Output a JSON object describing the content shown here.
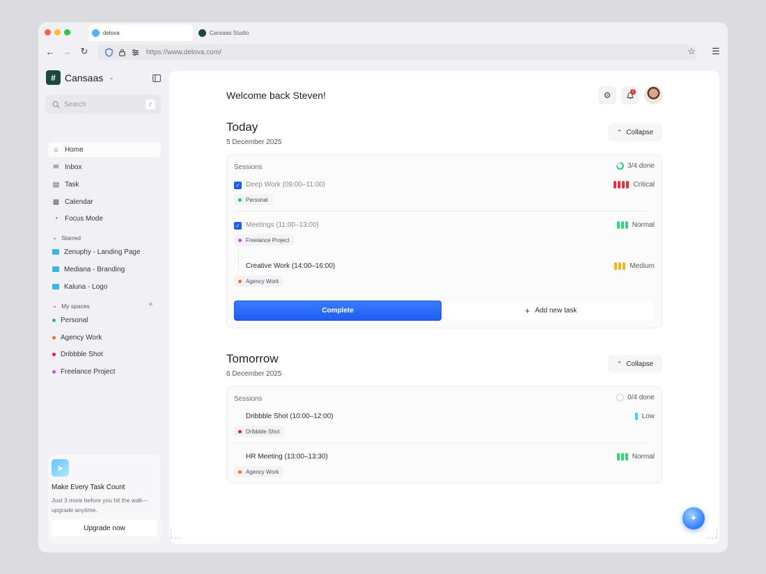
{
  "browser": {
    "tabs": [
      {
        "label": "delova",
        "favicon_color": "#4fb3ff"
      },
      {
        "label": "Cansaas Studio",
        "favicon_color": "#1b4a3c"
      }
    ],
    "url": "https://www.delova.com/"
  },
  "sidebar": {
    "brand": "Cansaas",
    "search_placeholder": "Search",
    "search_shortcut": "/",
    "nav": [
      {
        "label": "Home",
        "icon": "home-icon"
      },
      {
        "label": "Inbox",
        "icon": "mail-icon"
      },
      {
        "label": "Task",
        "icon": "task-icon"
      },
      {
        "label": "Calendar",
        "icon": "calendar-icon"
      },
      {
        "label": "Focus Mode",
        "icon": "focus-icon"
      }
    ],
    "starred_heading": "Starred",
    "starred": [
      "Zenuphy - Landing Page",
      "Mediana - Branding",
      "Kaluna - Logo"
    ],
    "spaces_heading": "My spaces",
    "spaces": [
      {
        "label": "Personal",
        "color": "#22c55e"
      },
      {
        "label": "Agency Work",
        "color": "#f97316"
      },
      {
        "label": "Dribbble Shot",
        "color": "#e11d48"
      },
      {
        "label": "Freelance Project",
        "color": "#d946ef"
      }
    ],
    "promo": {
      "title": "Make Every Task Count",
      "text": "Just 3 more before you hit the wall—upgrade anytime.",
      "button": "Upgrade now"
    }
  },
  "header": {
    "welcome": "Welcome back Steven!",
    "notifications": "2"
  },
  "today": {
    "title": "Today",
    "date": "5 December 2025",
    "collapse": "Collapse",
    "sessions_label": "Sessions",
    "done": "3/4 done",
    "tasks": [
      {
        "name": "Deep Work (09:00–11:00)",
        "tag": "Personal",
        "tag_color": "#22c55e",
        "priority": "Critical",
        "checked": true
      },
      {
        "name": "Meetings (11:00–13:00)",
        "tag": "Freelance Project",
        "tag_color": "#d946ef",
        "priority": "Normal",
        "checked": true
      },
      {
        "name": "Creative Work (14:00–16:00)",
        "tag": "Agency Work",
        "tag_color": "#f97316",
        "priority": "Medium",
        "checked": false
      }
    ],
    "complete_button": "Complete",
    "add_button": "Add new task"
  },
  "tomorrow": {
    "title": "Tomorrow",
    "date": "6 December 2025",
    "collapse": "Collapse",
    "sessions_label": "Sessions",
    "done": "0/4 done",
    "tasks": [
      {
        "name": "Dribbble Shot (10:00–12:00)",
        "tag": "Dribbble Shot",
        "tag_color": "#e11d48",
        "priority": "Low",
        "checked": false
      },
      {
        "name": "HR Meeting (13:00–13:30)",
        "tag": "Agency Work",
        "tag_color": "#f97316",
        "priority": "Normal",
        "checked": false
      }
    ]
  },
  "colors": {
    "accent": "#1f5df0",
    "critical": "#ef2b3c",
    "normal": "#34d27a",
    "medium": "#f7b21b",
    "low": "#38d6f5"
  }
}
